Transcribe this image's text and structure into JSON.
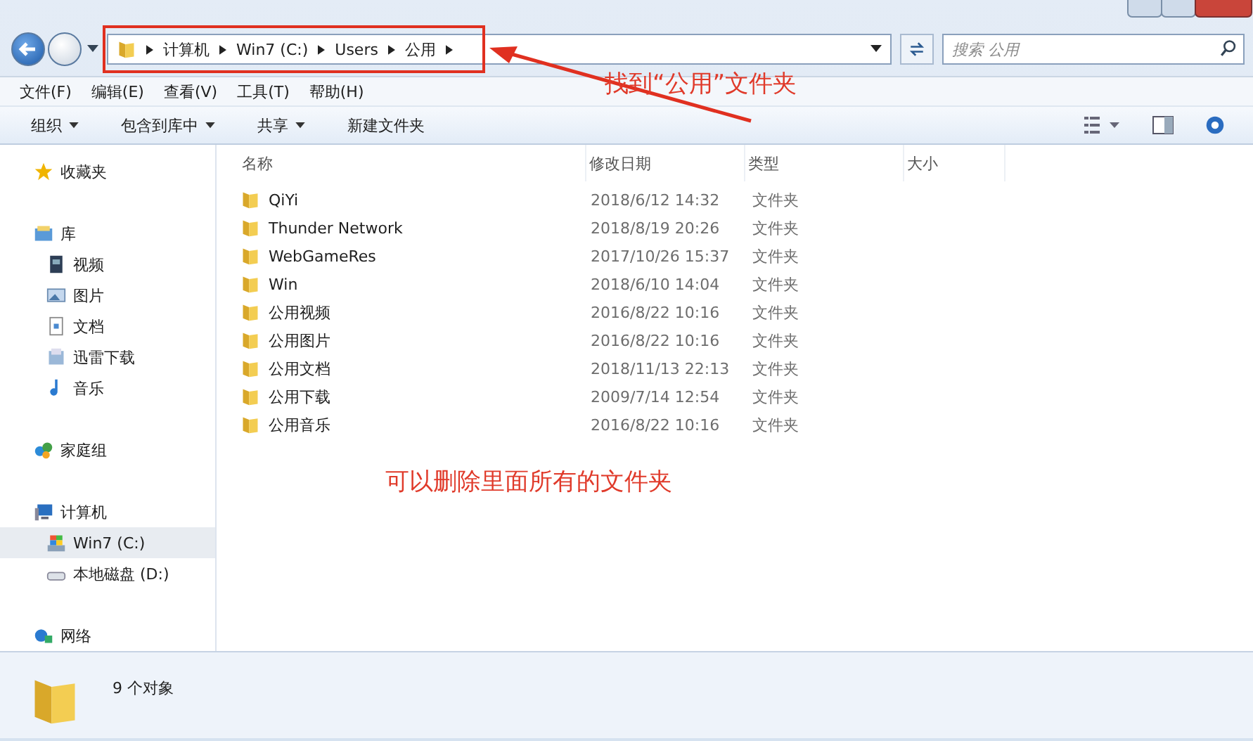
{
  "address": {
    "path": [
      "计算机",
      "Win7 (C:)",
      "Users",
      "公用"
    ]
  },
  "search": {
    "placeholder": "搜索 公用"
  },
  "menu": [
    "文件(F)",
    "编辑(E)",
    "查看(V)",
    "工具(T)",
    "帮助(H)"
  ],
  "toolbar": [
    {
      "label": "组织",
      "dropdown": true
    },
    {
      "label": "包含到库中",
      "dropdown": true
    },
    {
      "label": "共享",
      "dropdown": true
    },
    {
      "label": "新建文件夹",
      "dropdown": false
    }
  ],
  "sidebar": {
    "groups": [
      {
        "label": "收藏夹",
        "kind": "star",
        "selected": false
      },
      {
        "label": "库",
        "kind": "library",
        "selected": false,
        "children": [
          {
            "label": "视频",
            "kind": "video",
            "selected": false
          },
          {
            "label": "图片",
            "kind": "picture",
            "selected": false
          },
          {
            "label": "文档",
            "kind": "document",
            "selected": false
          },
          {
            "label": "迅雷下载",
            "kind": "download",
            "selected": false
          },
          {
            "label": "音乐",
            "kind": "music",
            "selected": false
          }
        ]
      },
      {
        "label": "家庭组",
        "kind": "homegroup",
        "selected": false
      },
      {
        "label": "计算机",
        "kind": "computer",
        "selected": false,
        "children": [
          {
            "label": "Win7 (C:)",
            "kind": "system-drive",
            "selected": true
          },
          {
            "label": "本地磁盘 (D:)",
            "kind": "drive",
            "selected": false
          }
        ]
      },
      {
        "label": "网络",
        "kind": "network",
        "selected": false
      }
    ]
  },
  "table": {
    "columns": [
      "名称",
      "修改日期",
      "类型",
      "大小"
    ],
    "rows": [
      {
        "name": "QiYi",
        "modified": "2018/6/12 14:32",
        "type": "文件夹"
      },
      {
        "name": "Thunder Network",
        "modified": "2018/8/19 20:26",
        "type": "文件夹"
      },
      {
        "name": "WebGameRes",
        "modified": "2017/10/26 15:37",
        "type": "文件夹"
      },
      {
        "name": "Win",
        "modified": "2018/6/10 14:04",
        "type": "文件夹"
      },
      {
        "name": "公用视频",
        "modified": "2016/8/22 10:16",
        "type": "文件夹"
      },
      {
        "name": "公用图片",
        "modified": "2016/8/22 10:16",
        "type": "文件夹"
      },
      {
        "name": "公用文档",
        "modified": "2018/11/13 22:13",
        "type": "文件夹"
      },
      {
        "name": "公用下载",
        "modified": "2009/7/14 12:54",
        "type": "文件夹"
      },
      {
        "name": "公用音乐",
        "modified": "2016/8/22 10:16",
        "type": "文件夹"
      }
    ]
  },
  "status_bar": {
    "count": "9 个对象"
  },
  "annotations": [
    {
      "kind": "callout",
      "text": "找到“公用”文件夹"
    },
    {
      "kind": "note",
      "text": "可以删除里面所有的文件夹"
    }
  ]
}
